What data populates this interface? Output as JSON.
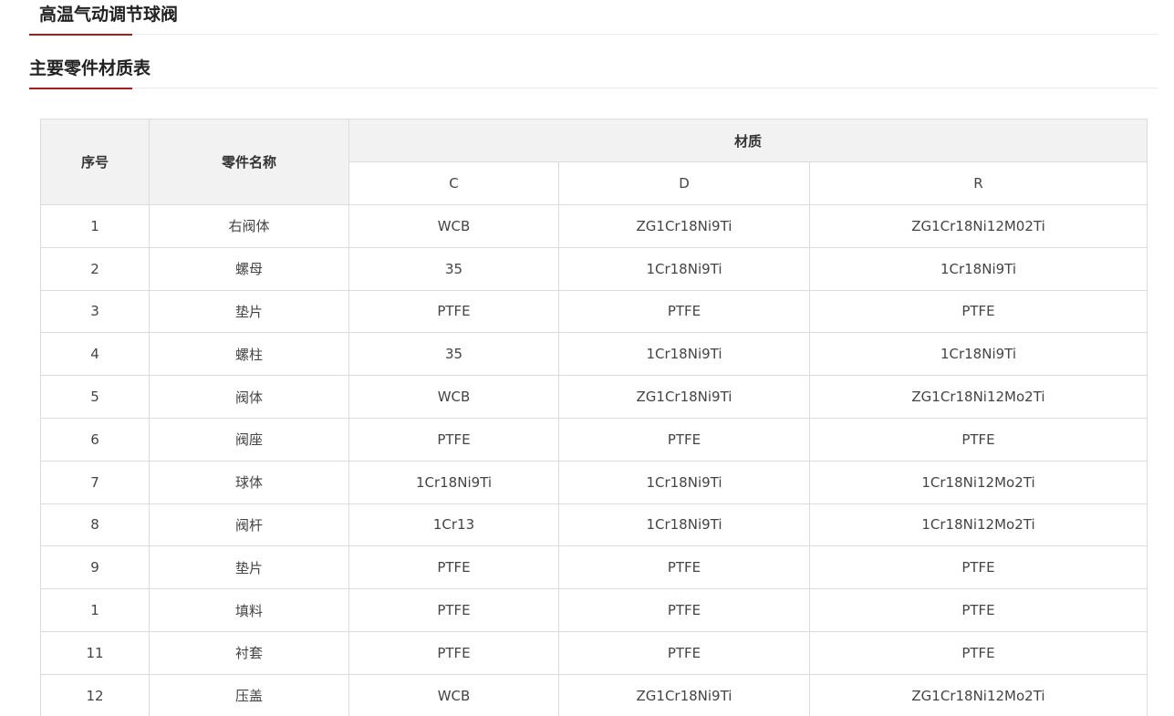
{
  "page": {
    "title": "高温气动调节球阀",
    "section_title": "主要零件材质表"
  },
  "colors": {
    "accent": "#a31e1e",
    "header_bg": "#f2f2f2",
    "border": "#dcdcdc"
  },
  "table": {
    "headers": {
      "index": "序号",
      "part_name": "零件名称",
      "material": "材质",
      "grades": [
        "C",
        "D",
        "R"
      ]
    },
    "rows": [
      {
        "no": "1",
        "name": "右阀体",
        "c": "WCB",
        "d": "ZG1Cr18Ni9Ti",
        "r": "ZG1Cr18Ni12M02Ti"
      },
      {
        "no": "2",
        "name": "螺母",
        "c": "35",
        "d": "1Cr18Ni9Ti",
        "r": "1Cr18Ni9Ti"
      },
      {
        "no": "3",
        "name": "垫片",
        "c": "PTFE",
        "d": "PTFE",
        "r": "PTFE"
      },
      {
        "no": "4",
        "name": "螺柱",
        "c": "35",
        "d": "1Cr18Ni9Ti",
        "r": "1Cr18Ni9Ti"
      },
      {
        "no": "5",
        "name": "阀体",
        "c": "WCB",
        "d": "ZG1Cr18Ni9Ti",
        "r": "ZG1Cr18Ni12Mo2Ti"
      },
      {
        "no": "6",
        "name": "阀座",
        "c": "PTFE",
        "d": "PTFE",
        "r": "PTFE"
      },
      {
        "no": "7",
        "name": "球体",
        "c": "1Cr18Ni9Ti",
        "d": "1Cr18Ni9Ti",
        "r": "1Cr18Ni12Mo2Ti"
      },
      {
        "no": "8",
        "name": "阀杆",
        "c": "1Cr13",
        "d": "1Cr18Ni9Ti",
        "r": "1Cr18Ni12Mo2Ti"
      },
      {
        "no": "9",
        "name": "垫片",
        "c": "PTFE",
        "d": "PTFE",
        "r": "PTFE"
      },
      {
        "no": "1",
        "name": "填料",
        "c": "PTFE",
        "d": "PTFE",
        "r": "PTFE"
      },
      {
        "no": "11",
        "name": "衬套",
        "c": "PTFE",
        "d": "PTFE",
        "r": "PTFE"
      },
      {
        "no": "12",
        "name": "压盖",
        "c": "WCB",
        "d": "ZG1Cr18Ni9Ti",
        "r": "ZG1Cr18Ni12Mo2Ti"
      }
    ]
  }
}
